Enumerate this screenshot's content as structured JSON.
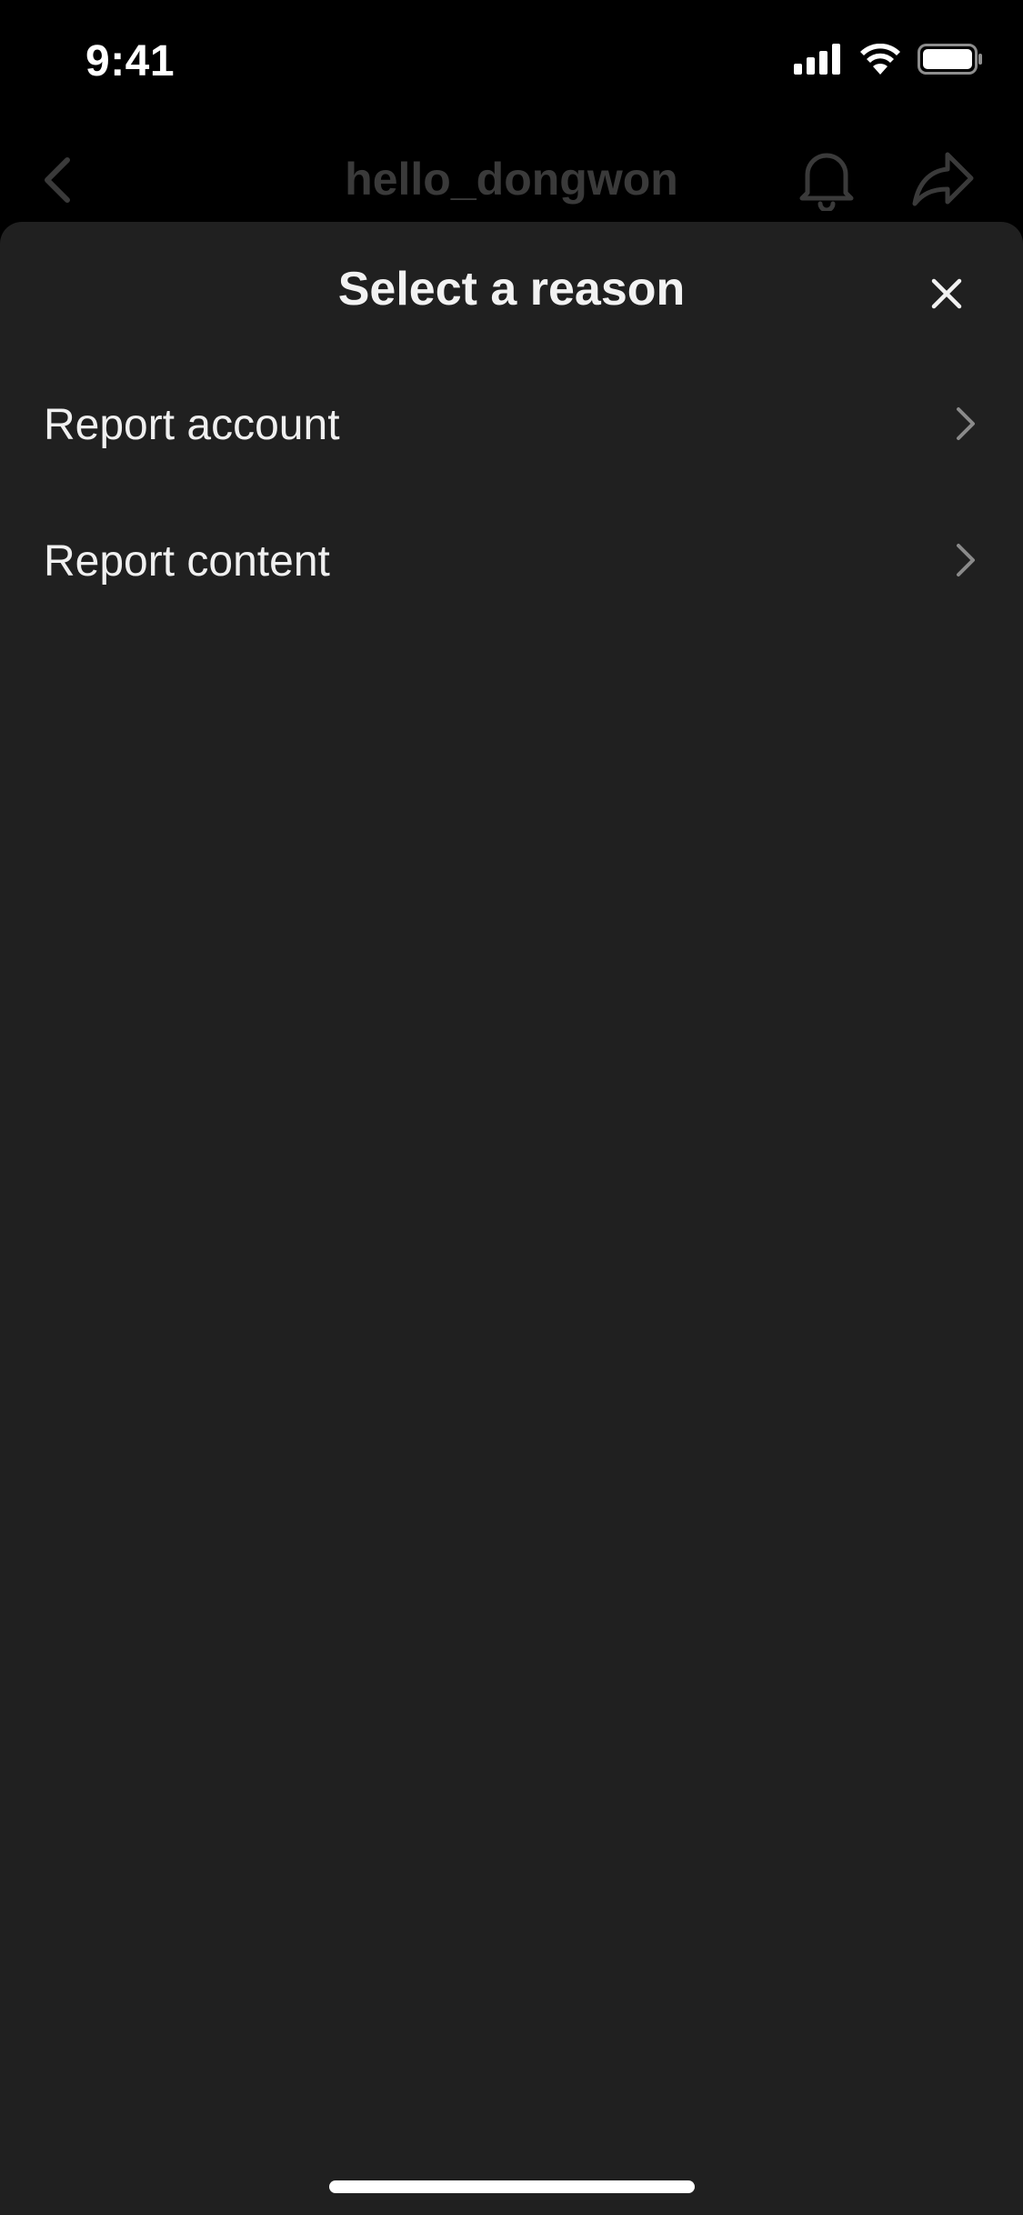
{
  "status_bar": {
    "time": "9:41",
    "icons": [
      "cellular-signal-icon",
      "wifi-icon",
      "battery-icon"
    ]
  },
  "background_nav": {
    "title": "hello_dongwon",
    "icons": [
      "chevron-left-icon",
      "bell-icon",
      "share-icon"
    ]
  },
  "sheet": {
    "title": "Select a reason",
    "close_icon": "close-icon",
    "items": [
      {
        "label": "Report account"
      },
      {
        "label": "Report content"
      }
    ]
  },
  "colors": {
    "screen_background": "#000000",
    "sheet_background": "#202020",
    "dimmed_text": "#3a3a3a",
    "primary_text": "#f0f0f0",
    "chevron": "#8a8a8a"
  }
}
